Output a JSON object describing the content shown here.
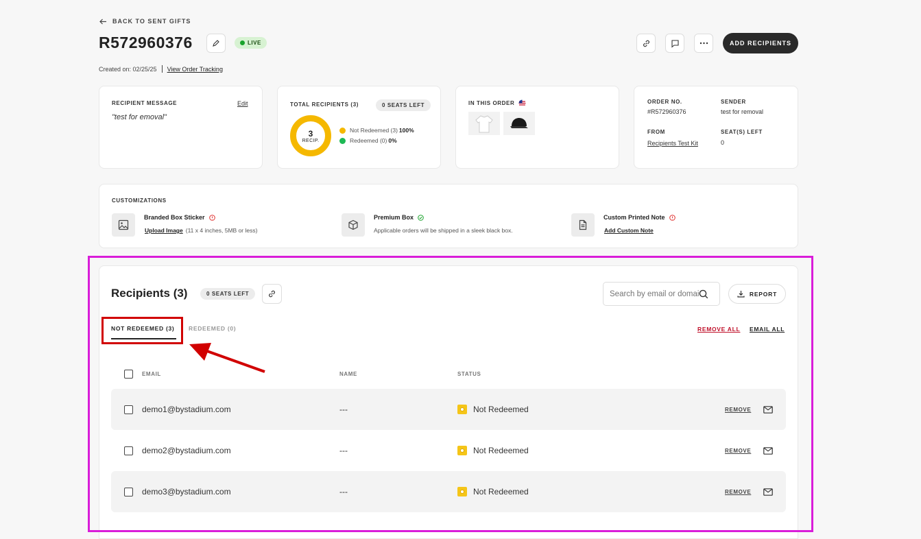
{
  "header": {
    "back_label": "BACK TO SENT GIFTS",
    "order_id": "R572960376",
    "status": "LIVE",
    "created_label": "Created on: 02/25/25",
    "tracking_link": "View Order Tracking",
    "add_recipients": "ADD RECIPIENTS"
  },
  "message_card": {
    "label": "RECIPIENT MESSAGE",
    "edit": "Edit",
    "message": "\"test for emoval\""
  },
  "recipients_card": {
    "label": "TOTAL RECIPIENTS (3)",
    "seats": "0 SEATS LEFT",
    "donut_value": "3",
    "donut_unit": "RECIP.",
    "legend": [
      {
        "label": "Not Redeemed (3)",
        "pct": "100%",
        "color": "#f5b800"
      },
      {
        "label": "Redeemed (0)",
        "pct": "0%",
        "color": "#1db954"
      }
    ]
  },
  "order_card": {
    "label": "IN THIS ORDER"
  },
  "info_card": {
    "order_no_label": "ORDER NO.",
    "order_no": "#R572960376",
    "sender_label": "SENDER",
    "sender": "test for removal",
    "from_label": "FROM",
    "from": "Recipients Test Kit",
    "seats_label": "SEAT(S) LEFT",
    "seats": "0"
  },
  "customizations": {
    "label": "CUSTOMIZATIONS",
    "items": [
      {
        "title": "Branded Box Sticker",
        "link": "Upload Image",
        "desc": "(11 x 4 inches, 5MB or less)"
      },
      {
        "title": "Premium Box",
        "desc": "Applicable orders will be shipped in a sleek black box."
      },
      {
        "title": "Custom Printed Note",
        "link": "Add Custom Note"
      }
    ]
  },
  "recipients": {
    "title": "Recipients (3)",
    "seats": "0 SEATS LEFT",
    "search_placeholder": "Search by email or domain",
    "report": "REPORT",
    "tabs": [
      "NOT REDEEMED (3)",
      "REDEEMED (0)"
    ],
    "remove_all": "REMOVE ALL",
    "email_all": "EMAIL ALL",
    "columns": [
      "EMAIL",
      "NAME",
      "STATUS"
    ],
    "rows": [
      {
        "email": "demo1@bystadium.com",
        "name": "---",
        "status": "Not Redeemed",
        "action": "REMOVE"
      },
      {
        "email": "demo2@bystadium.com",
        "name": "---",
        "status": "Not Redeemed",
        "action": "REMOVE"
      },
      {
        "email": "demo3@bystadium.com",
        "name": "---",
        "status": "Not Redeemed",
        "action": "REMOVE"
      }
    ]
  },
  "colors": {
    "accent_dark": "#2a2a2a",
    "highlight": "#d91dd9",
    "annotation": "#d10000",
    "remove_all": "#c0102a"
  }
}
